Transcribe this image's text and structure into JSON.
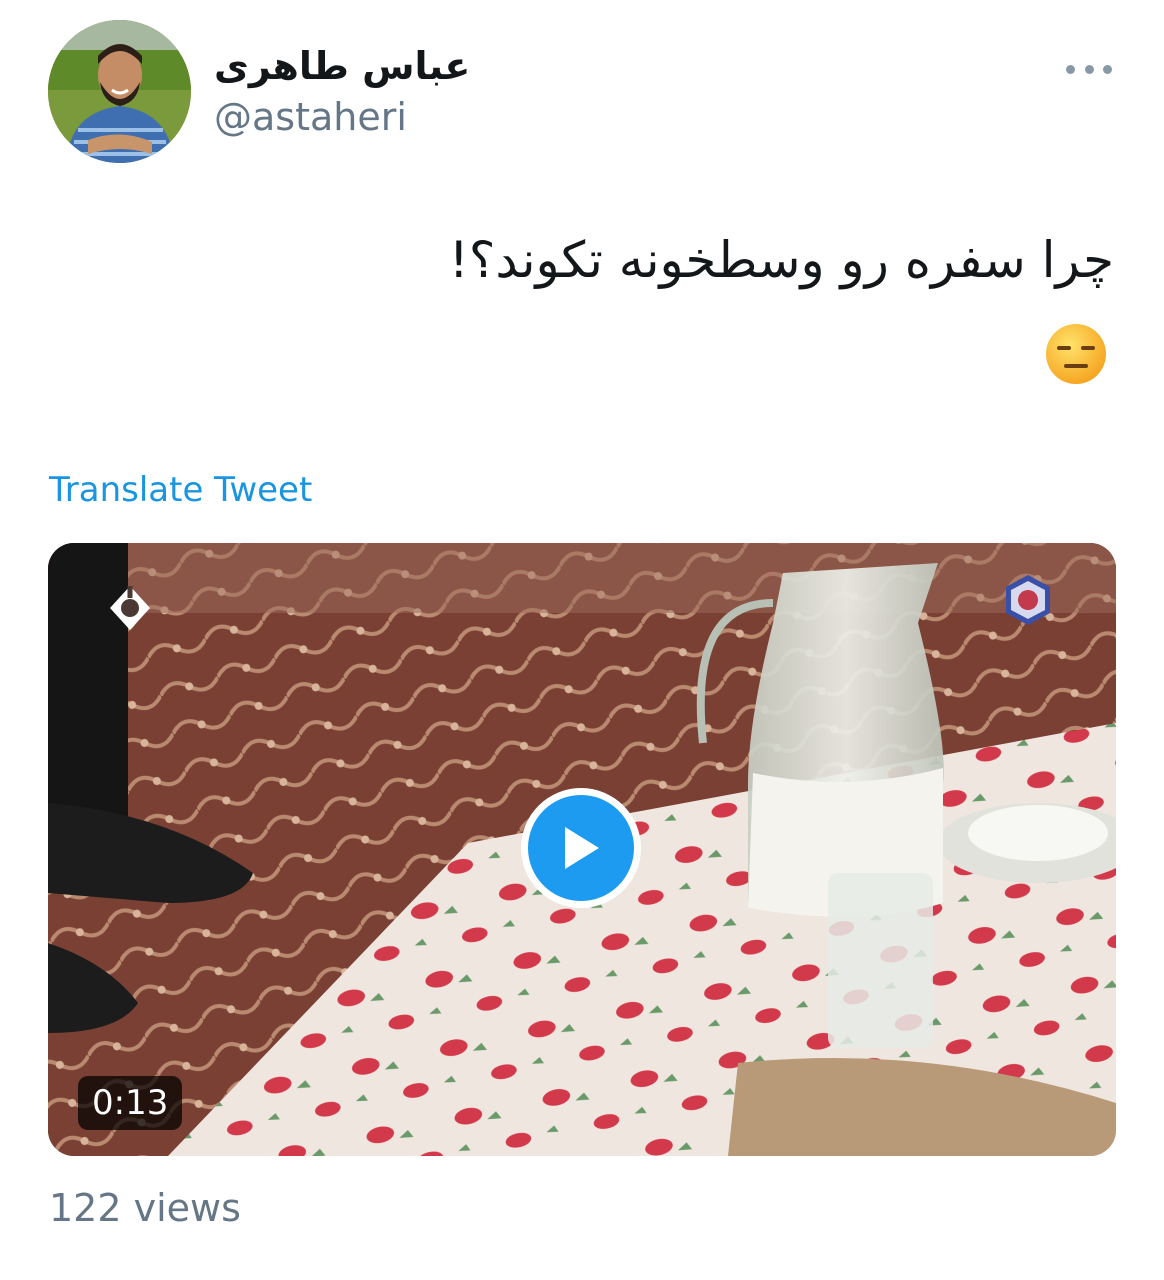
{
  "author": {
    "display_name": "عباس طاهری",
    "handle": "@astaheri",
    "avatar": "profile-photo"
  },
  "tweet": {
    "text": "چرا سفره رو وسطخونه تکوند؟!",
    "emoji": "expressionless-face-emoji",
    "translate_label": "Translate Tweet"
  },
  "media": {
    "type": "video",
    "duration": "0:13",
    "play_icon": "play-icon"
  },
  "stats": {
    "views": "122 views"
  },
  "colors": {
    "link": "#1b95e0",
    "play": "#1d9bf0",
    "secondary_text": "#657786"
  }
}
